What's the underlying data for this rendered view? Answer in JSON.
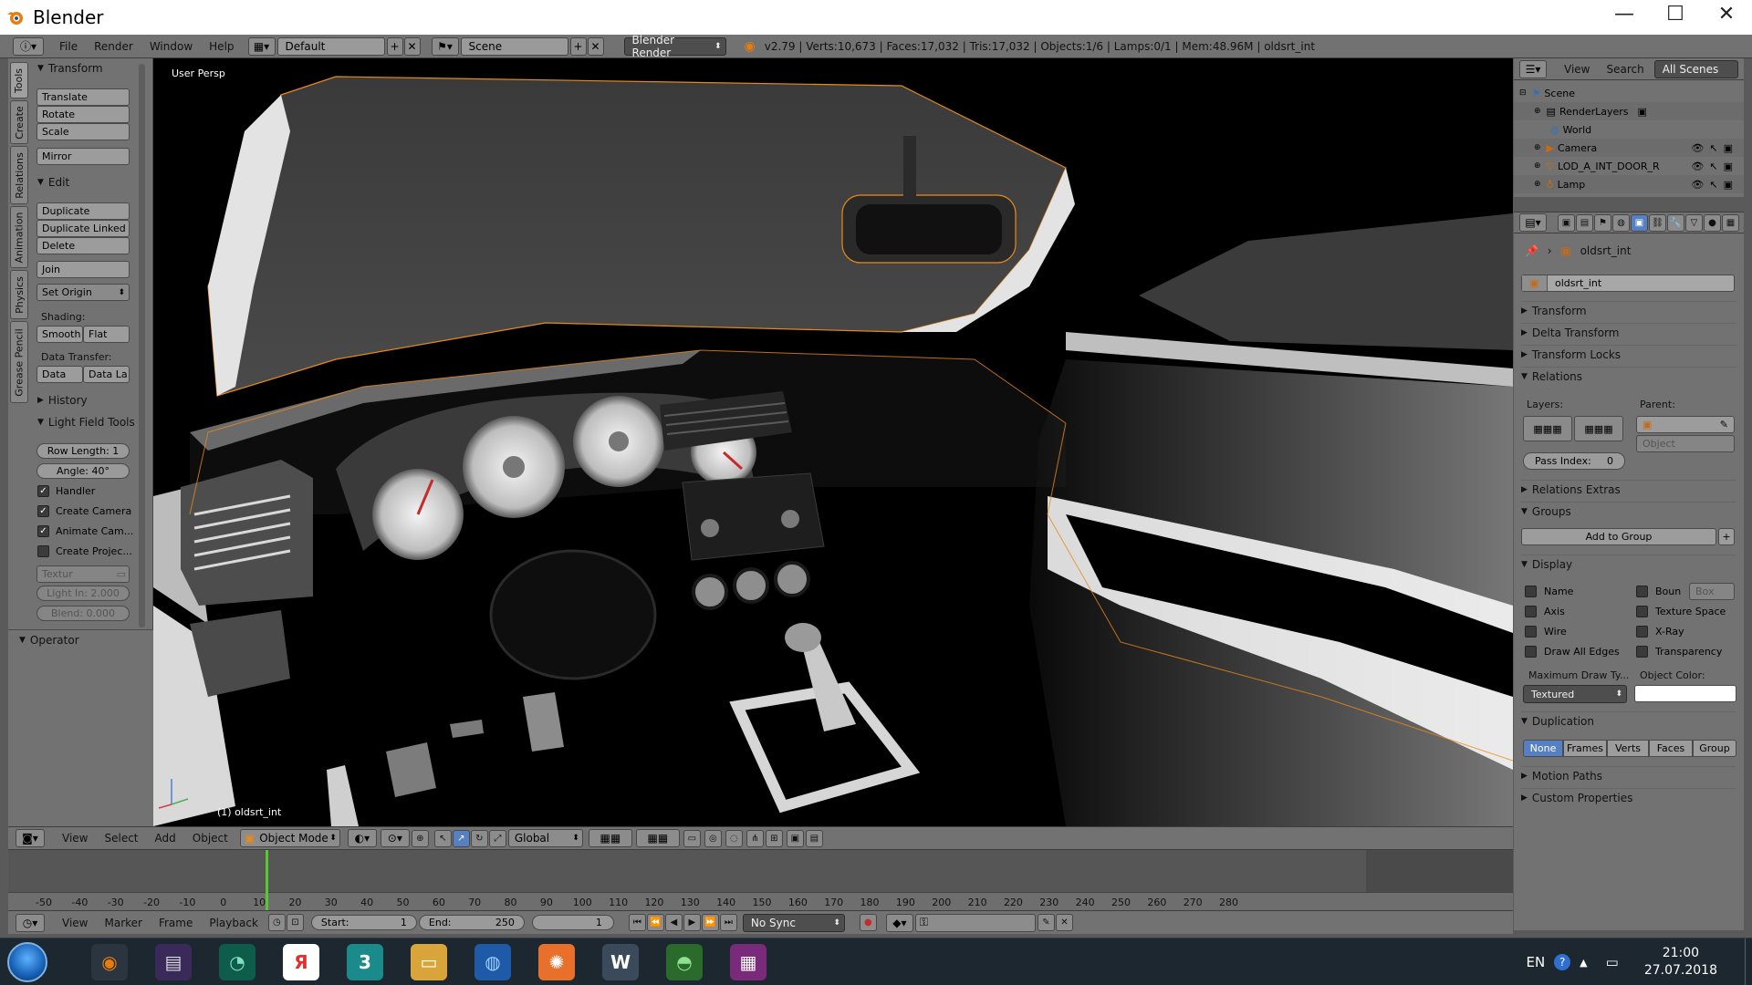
{
  "window": {
    "title": "Blender",
    "minimize": "—",
    "maximize": "☐",
    "close": "✕"
  },
  "menubar": {
    "menus": [
      "File",
      "Render",
      "Window",
      "Help"
    ],
    "layout": "Default",
    "scene": "Scene",
    "engine": "Blender Render",
    "stats": "v2.79 | Verts:10,673 | Faces:17,032 | Tris:17,032 | Objects:1/6 | Lamps:0/1 | Mem:48.96M | oldsrt_int"
  },
  "tabs": [
    "Tools",
    "Create",
    "Relations",
    "Animation",
    "Physics",
    "Grease Pencil"
  ],
  "toolshelf": {
    "transform_header": "Transform",
    "translate": "Translate",
    "rotate": "Rotate",
    "scale": "Scale",
    "mirror": "Mirror",
    "edit_header": "Edit",
    "duplicate": "Duplicate",
    "duplicate_linked": "Duplicate Linked",
    "delete": "Delete",
    "join": "Join",
    "set_origin": "Set Origin",
    "shading_label": "Shading:",
    "smooth": "Smooth",
    "flat": "Flat",
    "data_transfer_label": "Data Transfer:",
    "data": "Data",
    "data_layout": "Data La",
    "history_header": "History",
    "lightfield_header": "Light Field Tools",
    "row_length": "Row Length:  1",
    "angle": "Angle:        40°",
    "handler": "Handler",
    "create_camera": "Create Camera",
    "animate_camera": "Animate Cam...",
    "create_projector": "Create Projec...",
    "texture": "Textur",
    "light_int": "Light In: 2.000",
    "blend": "Blend:  0.000",
    "operator_header": "Operator"
  },
  "viewport": {
    "label": "User Persp",
    "object_label": "(1) oldsrt_int"
  },
  "vp_header": {
    "menus": [
      "View",
      "Select",
      "Add",
      "Object"
    ],
    "mode": "Object Mode",
    "orientation": "Global"
  },
  "timeline": {
    "ticks": [
      -50,
      -40,
      -30,
      -20,
      -10,
      0,
      10,
      20,
      30,
      40,
      50,
      60,
      70,
      80,
      90,
      100,
      110,
      120,
      130,
      140,
      150,
      160,
      170,
      180,
      190,
      200,
      210,
      220,
      230,
      240,
      250,
      260,
      270,
      280
    ],
    "current_frame": 1
  },
  "tl_header": {
    "menus": [
      "View",
      "Marker",
      "Frame",
      "Playback"
    ],
    "start": "Start:",
    "start_value": "1",
    "end": "End:",
    "end_value": "250",
    "frame_value": "1",
    "sync": "No Sync"
  },
  "outliner": {
    "view": "View",
    "search": "Search",
    "all_scenes": "All Scenes",
    "rows": [
      {
        "name": "Scene"
      },
      {
        "name": "RenderLayers"
      },
      {
        "name": "World"
      },
      {
        "name": "Camera"
      },
      {
        "name": "LOD_A_INT_DOOR_RIG"
      },
      {
        "name": "Lamp"
      }
    ]
  },
  "properties": {
    "object_path": "oldsrt_int",
    "object_name": "oldsrt_int",
    "transform": "Transform",
    "delta_transform": "Delta Transform",
    "transform_locks": "Transform Locks",
    "relations": "Relations",
    "layers_label": "Layers:",
    "parent_label": "Parent:",
    "parent_type": "Object",
    "pass_index": "Pass Index:",
    "pass_index_value": "0",
    "relations_extras": "Relations Extras",
    "groups": "Groups",
    "add_to_group": "Add to Group",
    "display": "Display",
    "name": "Name",
    "bounds": "Boun",
    "bounds_type": "Box",
    "axis": "Axis",
    "texture_space": "Texture Space",
    "wire": "Wire",
    "xray": "X-Ray",
    "draw_all_edges": "Draw All Edges",
    "transparency": "Transparency",
    "max_draw_type": "Maximum Draw Ty...",
    "object_color": "Object Color:",
    "draw_type_value": "Textured",
    "duplication": "Duplication",
    "dup_none": "None",
    "dup_frames": "Frames",
    "dup_verts": "Verts",
    "dup_faces": "Faces",
    "dup_group": "Group",
    "motion_paths": "Motion Paths",
    "custom_properties": "Custom Properties"
  },
  "taskbar": {
    "lang": "EN",
    "time": "21:00",
    "date": "27.07.2018",
    "apps": [
      "Blender",
      "WinRAR",
      "Monitor",
      "Yandex",
      "3ds Max",
      "Explorer",
      "Browser",
      "Ubuntu",
      "Word",
      "Network",
      "OneNote"
    ],
    "app_glyphs": [
      "◉",
      "▤",
      "◔",
      "Я",
      "3",
      "▭",
      "◍",
      "✺",
      "W",
      "◓",
      "▦"
    ]
  },
  "colors": {
    "accent_blue": "#5680c2",
    "selection_orange": "#e88a1a",
    "frame_green": "#55c832"
  }
}
